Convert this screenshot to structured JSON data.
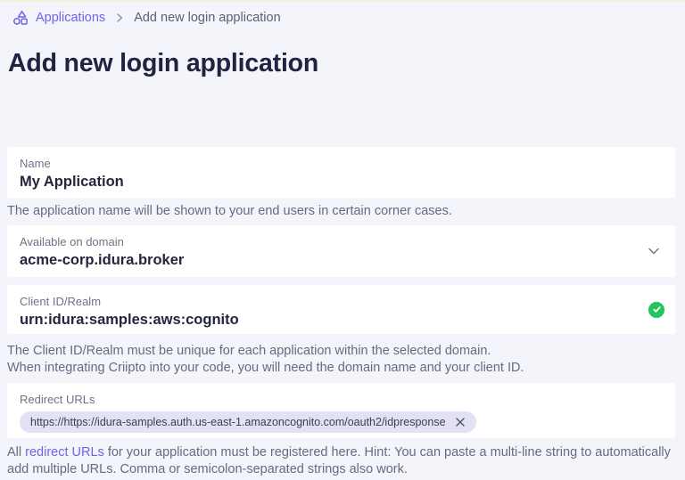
{
  "breadcrumb": {
    "root_label": "Applications",
    "current_label": "Add new login application"
  },
  "page_title": "Add new login application",
  "fields": {
    "name": {
      "label": "Name",
      "value": "My Application",
      "helper": "The application name will be shown to your end users in certain corner cases."
    },
    "domain": {
      "label": "Available on domain",
      "value": "acme-corp.idura.broker"
    },
    "client_id": {
      "label": "Client ID/Realm",
      "value": "urn:idura:samples:aws:cognito",
      "helper_line_1": "The Client ID/Realm must be unique for each application within the selected domain.",
      "helper_line_2": "When integrating Criipto into your code, you will need the domain name and your client ID."
    },
    "redirect_urls": {
      "label": "Redirect URLs",
      "chips": [
        {
          "url": "https://https://idura-samples.auth.us-east-1.amazoncognito.com/oauth2/idpresponse"
        }
      ],
      "helper_prefix": "All ",
      "helper_link_text": "redirect URLs",
      "helper_suffix": " for your application must be registered here. Hint: You can paste a multi-line string to automatically add multiple URLs. Comma or semicolon-separated strings also work."
    }
  },
  "colors": {
    "accent": "#7262e9",
    "success": "#22c55e",
    "page_background": "#f4f4fb",
    "field_background": "#ffffff",
    "chip_background": "#e3e1f6",
    "top_strip": "#f2f1da"
  }
}
